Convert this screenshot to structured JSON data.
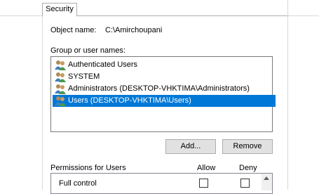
{
  "tab": {
    "label": "Security"
  },
  "object": {
    "label": "Object name:",
    "value": "C:\\Amirchoupani"
  },
  "group": {
    "label": "Group or user names:",
    "items": [
      {
        "label": "Authenticated Users"
      },
      {
        "label": "SYSTEM"
      },
      {
        "label": "Administrators (DESKTOP-VHKTIMA\\Administrators)"
      },
      {
        "label": "Users (DESKTOP-VHKTIMA\\Users)"
      }
    ],
    "selected_index": 3
  },
  "buttons": {
    "add": "Add...",
    "remove": "Remove"
  },
  "permissions": {
    "label": "Permissions for Users",
    "allow_header": "Allow",
    "deny_header": "Deny",
    "rows": [
      {
        "label": "Full control",
        "allow": false,
        "deny": false
      }
    ]
  },
  "colors": {
    "selection": "#0078d7",
    "button_face": "#e1e1e1"
  }
}
